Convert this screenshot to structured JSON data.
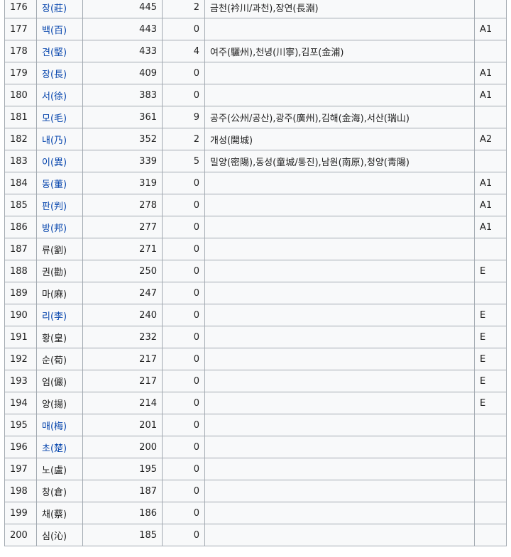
{
  "rows": [
    {
      "rank": "176",
      "name": "장(莊)",
      "linked": true,
      "population": "445",
      "clans": "2",
      "places": "금천(衿川/과천),장연(長淵)",
      "grade": ""
    },
    {
      "rank": "177",
      "name": "백(百)",
      "linked": true,
      "population": "443",
      "clans": "0",
      "places": "",
      "grade": "A1"
    },
    {
      "rank": "178",
      "name": "견(堅)",
      "linked": true,
      "population": "433",
      "clans": "4",
      "places": "여주(驪州),천녕(川寧),김포(金浦)",
      "grade": ""
    },
    {
      "rank": "179",
      "name": "장(長)",
      "linked": true,
      "population": "409",
      "clans": "0",
      "places": "",
      "grade": "A1"
    },
    {
      "rank": "180",
      "name": "서(徐)",
      "linked": true,
      "population": "383",
      "clans": "0",
      "places": "",
      "grade": "A1"
    },
    {
      "rank": "181",
      "name": "모(毛)",
      "linked": true,
      "population": "361",
      "clans": "9",
      "places": "공주(公州/공산),광주(廣州),김해(金海),서산(瑞山)",
      "grade": ""
    },
    {
      "rank": "182",
      "name": "내(乃)",
      "linked": true,
      "population": "352",
      "clans": "2",
      "places": "개성(開城)",
      "grade": "A2"
    },
    {
      "rank": "183",
      "name": "이(異)",
      "linked": true,
      "population": "339",
      "clans": "5",
      "places": "밀양(密陽),동성(童城/통진),남원(南原),청양(靑陽)",
      "grade": ""
    },
    {
      "rank": "184",
      "name": "동(董)",
      "linked": true,
      "population": "319",
      "clans": "0",
      "places": "",
      "grade": "A1"
    },
    {
      "rank": "185",
      "name": "판(判)",
      "linked": true,
      "population": "278",
      "clans": "0",
      "places": "",
      "grade": "A1"
    },
    {
      "rank": "186",
      "name": "방(邦)",
      "linked": true,
      "population": "277",
      "clans": "0",
      "places": "",
      "grade": "A1"
    },
    {
      "rank": "187",
      "name": "류(劉)",
      "linked": false,
      "population": "271",
      "clans": "0",
      "places": "",
      "grade": ""
    },
    {
      "rank": "188",
      "name": "권(勸)",
      "linked": false,
      "population": "250",
      "clans": "0",
      "places": "",
      "grade": "E"
    },
    {
      "rank": "189",
      "name": "마(麻)",
      "linked": false,
      "population": "247",
      "clans": "0",
      "places": "",
      "grade": ""
    },
    {
      "rank": "190",
      "name": "리(李)",
      "linked": true,
      "population": "240",
      "clans": "0",
      "places": "",
      "grade": "E"
    },
    {
      "rank": "191",
      "name": "황(皇)",
      "linked": false,
      "population": "232",
      "clans": "0",
      "places": "",
      "grade": "E"
    },
    {
      "rank": "192",
      "name": "순(荀)",
      "linked": false,
      "population": "217",
      "clans": "0",
      "places": "",
      "grade": "E"
    },
    {
      "rank": "193",
      "name": "엄(儼)",
      "linked": false,
      "population": "217",
      "clans": "0",
      "places": "",
      "grade": "E"
    },
    {
      "rank": "194",
      "name": "양(揚)",
      "linked": false,
      "population": "214",
      "clans": "0",
      "places": "",
      "grade": "E"
    },
    {
      "rank": "195",
      "name": "매(梅)",
      "linked": true,
      "population": "201",
      "clans": "0",
      "places": "",
      "grade": ""
    },
    {
      "rank": "196",
      "name": "초(楚)",
      "linked": true,
      "population": "200",
      "clans": "0",
      "places": "",
      "grade": ""
    },
    {
      "rank": "197",
      "name": "노(盧)",
      "linked": false,
      "population": "195",
      "clans": "0",
      "places": "",
      "grade": ""
    },
    {
      "rank": "198",
      "name": "창(倉)",
      "linked": false,
      "population": "187",
      "clans": "0",
      "places": "",
      "grade": ""
    },
    {
      "rank": "199",
      "name": "채(蔡)",
      "linked": false,
      "population": "186",
      "clans": "0",
      "places": "",
      "grade": ""
    },
    {
      "rank": "200",
      "name": "심(沁)",
      "linked": false,
      "population": "185",
      "clans": "0",
      "places": "",
      "grade": ""
    }
  ],
  "colors": {
    "link": "#0645ad",
    "text": "#222222",
    "border": "#a2a9b1",
    "cell_background": "#f8f9fa"
  }
}
